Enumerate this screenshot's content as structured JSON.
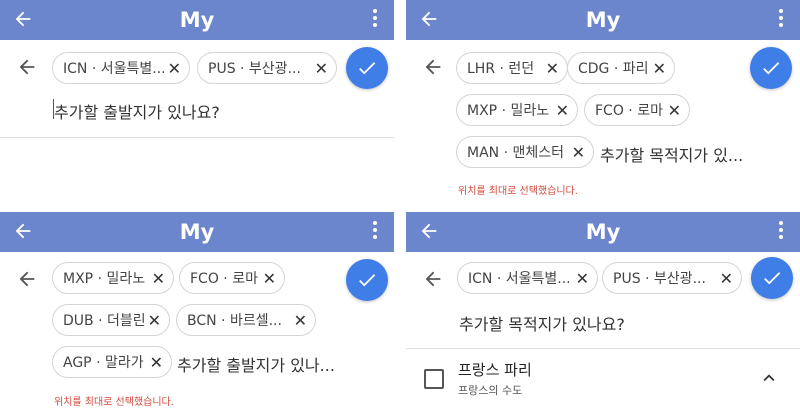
{
  "app": {
    "title": "My"
  },
  "panels": {
    "top_left": {
      "chips": [
        {
          "label": "ICN · 서울특별...",
          "remove": "✕"
        },
        {
          "label": "PUS · 부산광...",
          "remove": "✕"
        }
      ],
      "prompt": "추가할 출발지가 있나요?"
    },
    "top_right": {
      "chips": [
        {
          "label": "LHR · 런던",
          "remove": "✕"
        },
        {
          "label": "CDG · 파리",
          "remove": "✕"
        },
        {
          "label": "MXP · 밀라노",
          "remove": "✕"
        },
        {
          "label": "FCO · 로마",
          "remove": "✕"
        },
        {
          "label": "MAN · 맨체스터",
          "remove": "✕"
        }
      ],
      "prompt": "추가할 목적지가 있...",
      "error": "위치를 최대로 선택했습니다."
    },
    "bottom_left": {
      "chips": [
        {
          "label": "MXP · 밀라노",
          "remove": "✕"
        },
        {
          "label": "FCO · 로마",
          "remove": "✕"
        },
        {
          "label": "DUB · 더블린",
          "remove": "✕"
        },
        {
          "label": "BCN · 바르셀...",
          "remove": "✕"
        },
        {
          "label": "AGP · 말라가",
          "remove": "✕"
        }
      ],
      "prompt": "추가할 출발지가 있나...",
      "error": "위치를 최대로 선택했습니다."
    },
    "bottom_right": {
      "chips": [
        {
          "label": "ICN · 서울특별...",
          "remove": "✕"
        },
        {
          "label": "PUS · 부산광...",
          "remove": "✕"
        }
      ],
      "prompt": "추가할 목적지가 있나요?",
      "result": {
        "title": "프랑스 파리",
        "subtitle": "프랑스의 수도"
      }
    }
  },
  "icons": {
    "header_back": "arrow-left-icon",
    "header_more": "more-vert-icon",
    "search_back": "arrow-left-icon",
    "confirm": "check-icon",
    "chip_remove": "close-icon",
    "checkbox": "checkbox-icon",
    "expand": "chevron-up-icon"
  },
  "colors": {
    "header": "#6b86cc",
    "fab": "#3f7ee6",
    "error": "#d24b3f"
  }
}
